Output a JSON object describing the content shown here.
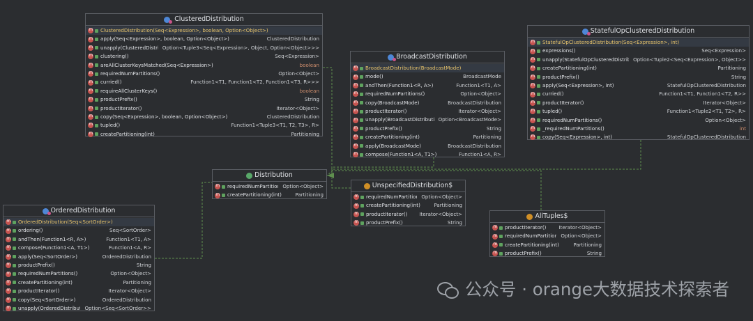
{
  "classes": {
    "clustered": {
      "title": "ClusteredDistribution",
      "members": [
        {
          "sig": "ClusteredDistribution(Seq<Expression>, boolean, Option<Object>)",
          "ret": "",
          "ctor": true
        },
        {
          "sig": "apply(Seq<Expression>, boolean, Option<Object>)",
          "ret": "ClusteredDistribution"
        },
        {
          "sig": "unapply(ClusteredDistribution)",
          "ret": "Option<Tuple3<Seq<Expression>, Object, Option<Object>>>"
        },
        {
          "sig": "clustering()",
          "ret": "Seq<Expression>"
        },
        {
          "sig": "areAllClusterKeysMatched(Seq<Expression>)",
          "ret": "boolean"
        },
        {
          "sig": "requiredNumPartitions()",
          "ret": "Option<Object>"
        },
        {
          "sig": "curried()",
          "ret": "Function1<T1, Function1<T2, Function1<T3, R>>>"
        },
        {
          "sig": "requireAllClusterKeys()",
          "ret": "boolean"
        },
        {
          "sig": "productPrefix()",
          "ret": "String"
        },
        {
          "sig": "productIterator()",
          "ret": "Iterator<Object>"
        },
        {
          "sig": "copy(Seq<Expression>, boolean, Option<Object>)",
          "ret": "ClusteredDistribution"
        },
        {
          "sig": "tupled()",
          "ret": "Function1<Tuple3<T1, T2, T3>, R>"
        },
        {
          "sig": "createPartitioning(int)",
          "ret": "Partitioning"
        }
      ]
    },
    "broadcast": {
      "title": "BroadcastDistribution",
      "members": [
        {
          "sig": "BroadcastDistribution(BroadcastMode)",
          "ret": "",
          "ctor": true
        },
        {
          "sig": "mode()",
          "ret": "BroadcastMode"
        },
        {
          "sig": "andThen(Function1<R, A>)",
          "ret": "Function1<T1, A>"
        },
        {
          "sig": "requiredNumPartitions()",
          "ret": "Option<Object>"
        },
        {
          "sig": "copy(BroadcastMode)",
          "ret": "BroadcastDistribution"
        },
        {
          "sig": "productIterator()",
          "ret": "Iterator<Object>"
        },
        {
          "sig": "unapply(BroadcastDistribution)",
          "ret": "Option<BroadcastMode>"
        },
        {
          "sig": "productPrefix()",
          "ret": "String"
        },
        {
          "sig": "createPartitioning(int)",
          "ret": "Partitioning"
        },
        {
          "sig": "apply(BroadcastMode)",
          "ret": "BroadcastDistribution"
        },
        {
          "sig": "compose(Function1<A, T1>)",
          "ret": "Function1<A, R>"
        }
      ]
    },
    "stateful": {
      "title": "StatefulOpClusteredDistribution",
      "members": [
        {
          "sig": "StatefulOpClusteredDistribution(Seq<Expression>, int)",
          "ret": "",
          "ctor": true
        },
        {
          "sig": "expressions()",
          "ret": "Seq<Expression>"
        },
        {
          "sig": "unapply(StatefulOpClusteredDistribution)",
          "ret": "Option<Tuple2<Seq<Expression>, Object>>"
        },
        {
          "sig": "createPartitioning(int)",
          "ret": "Partitioning"
        },
        {
          "sig": "productPrefix()",
          "ret": "String"
        },
        {
          "sig": "apply(Seq<Expression>, int)",
          "ret": "StatefulOpClusteredDistribution"
        },
        {
          "sig": "curried()",
          "ret": "Function1<T1, Function1<T2, R>>"
        },
        {
          "sig": "productIterator()",
          "ret": "Iterator<Object>"
        },
        {
          "sig": "tupled()",
          "ret": "Function1<Tuple2<T1, T2>, R>"
        },
        {
          "sig": "requiredNumPartitions()",
          "ret": "Option<Object>"
        },
        {
          "sig": "_requiredNumPartitions()",
          "ret": "int"
        },
        {
          "sig": "copy(Seq<Expression>, int)",
          "ret": "StatefulOpClusteredDistribution"
        }
      ]
    },
    "distribution": {
      "title": "Distribution",
      "members": [
        {
          "sig": "requiredNumPartitions()",
          "ret": "Option<Object>"
        },
        {
          "sig": "createPartitioning(int)",
          "ret": "Partitioning"
        }
      ]
    },
    "unspecified": {
      "title": "UnspecifiedDistribution$",
      "members": [
        {
          "sig": "requiredNumPartitions()",
          "ret": "Option<Object>"
        },
        {
          "sig": "createPartitioning(int)",
          "ret": "Partitioning"
        },
        {
          "sig": "productIterator()",
          "ret": "Iterator<Object>"
        },
        {
          "sig": "productPrefix()",
          "ret": "String"
        }
      ]
    },
    "ordered": {
      "title": "OrderedDistribution",
      "members": [
        {
          "sig": "OrderedDistribution(Seq<SortOrder>)",
          "ret": "",
          "ctor": true
        },
        {
          "sig": "ordering()",
          "ret": "Seq<SortOrder>"
        },
        {
          "sig": "andThen(Function1<R, A>)",
          "ret": "Function1<T1, A>"
        },
        {
          "sig": "compose(Function1<A, T1>)",
          "ret": "Function1<A, R>"
        },
        {
          "sig": "apply(Seq<SortOrder>)",
          "ret": "OrderedDistribution"
        },
        {
          "sig": "productPrefix()",
          "ret": "String"
        },
        {
          "sig": "requiredNumPartitions()",
          "ret": "Option<Object>"
        },
        {
          "sig": "createPartitioning(int)",
          "ret": "Partitioning"
        },
        {
          "sig": "productIterator()",
          "ret": "Iterator<Object>"
        },
        {
          "sig": "copy(Seq<SortOrder>)",
          "ret": "OrderedDistribution"
        },
        {
          "sig": "unapply(OrderedDistribution)",
          "ret": "Option<Seq<SortOrder>>"
        }
      ]
    },
    "alltuples": {
      "title": "AllTuples$",
      "members": [
        {
          "sig": "productIterator()",
          "ret": "Iterator<Object>"
        },
        {
          "sig": "requiredNumPartitions()",
          "ret": "Option<Object>"
        },
        {
          "sig": "createPartitioning(int)",
          "ret": "Partitioning"
        },
        {
          "sig": "productPrefix()",
          "ret": "String"
        }
      ]
    }
  },
  "watermark": {
    "text": "公众号 · orange大数据技术探索者",
    "icon": "wechat-icon"
  },
  "colors": {
    "background": "#2b2d30",
    "border": "#5a5d63",
    "edge": "#5f8f4e",
    "keyword": "#cf8e6d",
    "ctor": "#e8c46b"
  }
}
